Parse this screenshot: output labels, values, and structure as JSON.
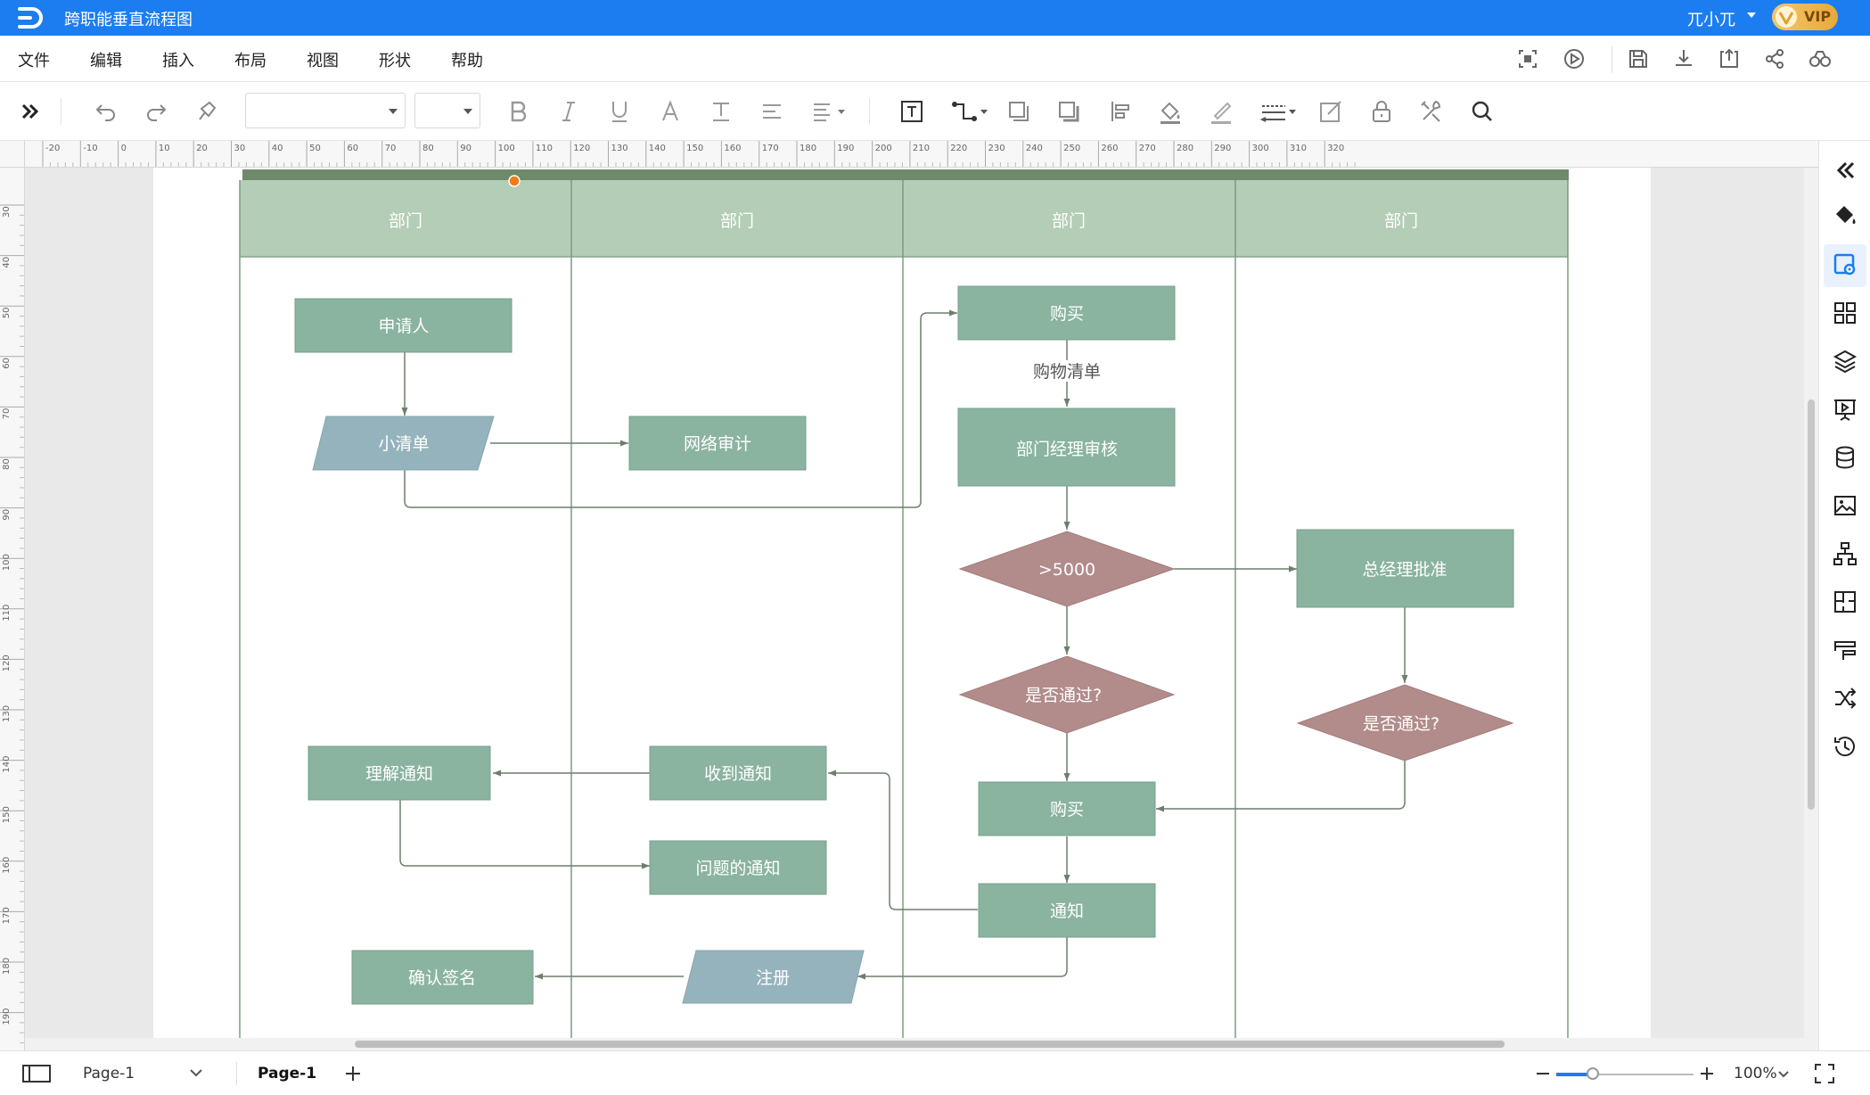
{
  "title_bar": {
    "doc_title": "跨职能垂直流程图",
    "user_name": "兀小兀",
    "vip_label": "VIP"
  },
  "menu": {
    "items": [
      "文件",
      "编辑",
      "插入",
      "布局",
      "视图",
      "形状",
      "帮助"
    ]
  },
  "toolbar": {
    "font_value": "",
    "font_size_value": ""
  },
  "ruler": {
    "h_labels": [
      "-20",
      "-10",
      "0",
      "10",
      "20",
      "30",
      "40",
      "50",
      "60",
      "70",
      "80",
      "90",
      "100",
      "110",
      "120",
      "130",
      "140",
      "150",
      "160",
      "170",
      "180",
      "190",
      "200",
      "210",
      "220",
      "230",
      "240",
      "250",
      "260",
      "270",
      "280",
      "290",
      "300",
      "310",
      "320"
    ],
    "v_labels": [
      "30",
      "40",
      "50",
      "60",
      "70",
      "80",
      "90",
      "100",
      "110",
      "120",
      "130",
      "140",
      "150",
      "160",
      "170",
      "180",
      "190"
    ]
  },
  "diagram": {
    "lanes": [
      "部门",
      "部门",
      "部门",
      "部门"
    ],
    "nodes": {
      "applicant": "申请人",
      "small_list": "小清单",
      "network_audit": "网络审计",
      "purchase_top": "购买",
      "shopping_list": "购物清单",
      "dept_manager_review": "部门经理审核",
      "gt5000": ">5000",
      "gm_approve": "总经理批准",
      "pass_check_1": "是否通过?",
      "pass_check_2": "是否通过?",
      "understand_notice": "理解通知",
      "receive_notice": "收到通知",
      "purchase_bottom": "购买",
      "problem_notice": "问题的通知",
      "notify": "通知",
      "confirm_sign": "确认签名",
      "register": "注册"
    },
    "colors": {
      "lane_header": "#b4cdb6",
      "lane_top_bar": "#6d8a6b",
      "process": "#8ab3a0",
      "data": "#95b3bd",
      "decision": "#b28b8b",
      "line": "#6d7f6d"
    }
  },
  "status_bar": {
    "page_selector": "Page-1",
    "active_tab": "Page-1",
    "zoom": "100%"
  }
}
